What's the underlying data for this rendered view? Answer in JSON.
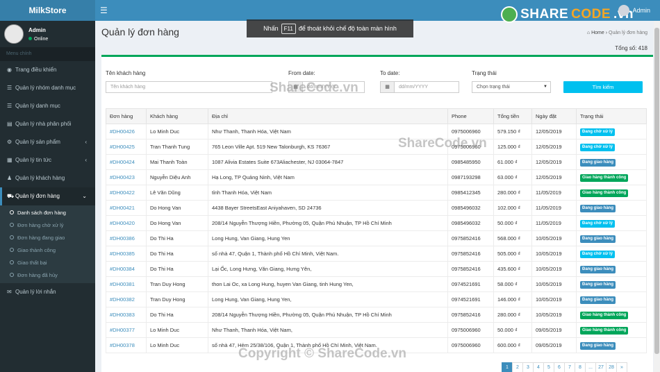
{
  "app": {
    "brand": "MilkStore"
  },
  "header": {
    "menu_icon": "hamburger-icon",
    "user_name": "Admin",
    "sharecode_part1": "SHARE",
    "sharecode_part2": "CODE",
    "sharecode_suffix": ".vn"
  },
  "sidebar": {
    "user": {
      "name": "Admin",
      "status": "Online"
    },
    "section_header": "Menu chính",
    "items": [
      {
        "label": "Trang điều khiển",
        "icon": "dashboard-icon",
        "glyph": "◉"
      },
      {
        "label": "Quản lý nhóm danh mục",
        "icon": "list-icon",
        "glyph": "☰"
      },
      {
        "label": "Quản lý danh mục",
        "icon": "list-icon",
        "glyph": "☰"
      },
      {
        "label": "Quản lý nhà phân phối",
        "icon": "chart-icon",
        "glyph": "▤"
      },
      {
        "label": "Quản lý sản phẩm",
        "icon": "gear-icon",
        "glyph": "⚙"
      },
      {
        "label": "Quản lý tin tức",
        "icon": "newspaper-icon",
        "glyph": "▦"
      },
      {
        "label": "Quản lý khách hàng",
        "icon": "users-icon",
        "glyph": "♟"
      },
      {
        "label": "Quản lý đơn hàng",
        "icon": "cart-icon",
        "glyph": "⛟"
      },
      {
        "label": "Quản lý lời nhắn",
        "icon": "comment-icon",
        "glyph": "✉"
      }
    ],
    "orders_submenu": [
      "Danh sách đơn hàng",
      "Đơn hàng chờ xử lý",
      "Đơn hàng đang giao",
      "Giao thành công",
      "Giao thất bại",
      "Đơn hàng đã hủy"
    ]
  },
  "fullscreen_tip": {
    "before": "Nhấn",
    "key": "F11",
    "after": "để thoát khỏi chế độ toàn màn hình"
  },
  "page": {
    "title": "Quản lý đơn hàng",
    "breadcrumb_home": "Home",
    "breadcrumb_current": "Quản lý đơn hàng",
    "total": "Tổng số: 418"
  },
  "filters": {
    "customer_label": "Tên khách hàng",
    "customer_placeholder": "Tên khách hàng",
    "from_label": "From date:",
    "to_label": "To date:",
    "date_placeholder": "dd/mm/YYYY",
    "status_label": "Trạng thái",
    "status_value": "Chọn trạng thái",
    "search_button": "Tìm kiếm"
  },
  "table": {
    "headers": [
      "Đơn hàng",
      "Khách hàng",
      "Địa chỉ",
      "Phone",
      "Tổng tiền",
      "Ngày đặt",
      "Trạng thái"
    ],
    "rows": [
      [
        "#DH00426",
        "Lo Minh Duc",
        "Như Thanh, Thanh Hóa, Việt Nam",
        "0975006960",
        "579.150 ₫",
        "12/05/2019",
        "Đang chờ xử lý"
      ],
      [
        "#DH00425",
        "Tran Thanh Tung",
        "765 Leon Ville Apt. 519 New Talonburgh, KS 76367",
        "0975006960",
        "125.000 ₫",
        "12/05/2019",
        "Đang chờ xử lý"
      ],
      [
        "#DH00424",
        "Mai Thanh Toàn",
        "1087 Alivia Estates Suite 673Aliachester, NJ 03064-7847",
        "0985485950",
        "61.000 ₫",
        "12/05/2019",
        "Đang giao hàng"
      ],
      [
        "#DH00423",
        "Nguyễn Diệu Anh",
        "Hạ Long, TP Quảng Ninh, Việt Nam",
        "0987193298",
        "63.000 ₫",
        "12/05/2019",
        "Giao hàng thành công"
      ],
      [
        "#DH00422",
        "Lê Văn Dũng",
        "tỉnh Thanh Hóa, Việt Nam",
        "0985412345",
        "280.000 ₫",
        "11/05/2019",
        "Giao hàng thành công"
      ],
      [
        "#DH00421",
        "Do Hong Van",
        "4438 Bayer StreetsEast Aniyahaven, SD 24736",
        "0985496032",
        "102.000 ₫",
        "11/05/2019",
        "Đang giao hàng"
      ],
      [
        "#DH00420",
        "Do Hong Van",
        "208/14 Nguyễn Thượng Hiền, Phường 05, Quận Phú Nhuận, TP Hồ Chí Minh",
        "0985496032",
        "50.000 ₫",
        "11/05/2019",
        "Đang chờ xử lý"
      ],
      [
        "#DH00386",
        "Do Thi Ha",
        "Long Hung, Van Giang, Hung Yen",
        "0975852416",
        "568.000 ₫",
        "10/05/2019",
        "Đang giao hàng"
      ],
      [
        "#DH00385",
        "Do Thi Ha",
        "số nhà 47, Quận 1, Thành phố Hồ Chí Minh, Việt Nam.",
        "0975852416",
        "505.000 ₫",
        "10/05/2019",
        "Đang chờ xử lý"
      ],
      [
        "#DH00384",
        "Do Thi Ha",
        "Lại Ốc, Long Hưng, Văn Giang, Hưng Yên,",
        "0975852416",
        "435.600 ₫",
        "10/05/2019",
        "Đang giao hàng"
      ],
      [
        "#DH00381",
        "Tran Duy Hong",
        "thon Lai Oc, xa Long Hung, huyen Van Giang, tinh Hung Yen,",
        "0974521691",
        "58.000 ₫",
        "10/05/2019",
        "Đang giao hàng"
      ],
      [
        "#DH00382",
        "Tran Duy Hong",
        "Long Hung, Van Giang, Hung Yen,",
        "0974521691",
        "146.000 ₫",
        "10/05/2019",
        "Đang giao hàng"
      ],
      [
        "#DH00383",
        "Do Thi Ha",
        "208/14 Nguyễn Thượng Hiền, Phường 05, Quận Phú Nhuận, TP Hồ Chí Minh",
        "0975852416",
        "280.000 ₫",
        "10/05/2019",
        "Giao hàng thành công"
      ],
      [
        "#DH00377",
        "Lo Minh Duc",
        "Như Thanh, Thanh Hóa, Việt Nam,",
        "0975006960",
        "50.000 ₫",
        "09/05/2019",
        "Giao hàng thành công"
      ],
      [
        "#DH00378",
        "Lo Minh Duc",
        "số nhà 47, Hẻm 25/38/106, Quận 1, Thành phố Hồ Chí Minh, Việt Nam.",
        "0975006960",
        "600.000 ₫",
        "09/05/2019",
        "Đang giao hàng"
      ]
    ]
  },
  "status_colors": {
    "Đang chờ xử lý": "#00c0ef",
    "Đang giao hàng": "#3c8dbc",
    "Giao hàng thành công": "#00a65a"
  },
  "pagination": [
    "1",
    "2",
    "3",
    "4",
    "5",
    "6",
    "7",
    "8",
    "...",
    "27",
    "28",
    "»"
  ],
  "watermarks": [
    "ShareCode.vn",
    "ShareCode.vn",
    "Copyright © ShareCode.vn"
  ]
}
